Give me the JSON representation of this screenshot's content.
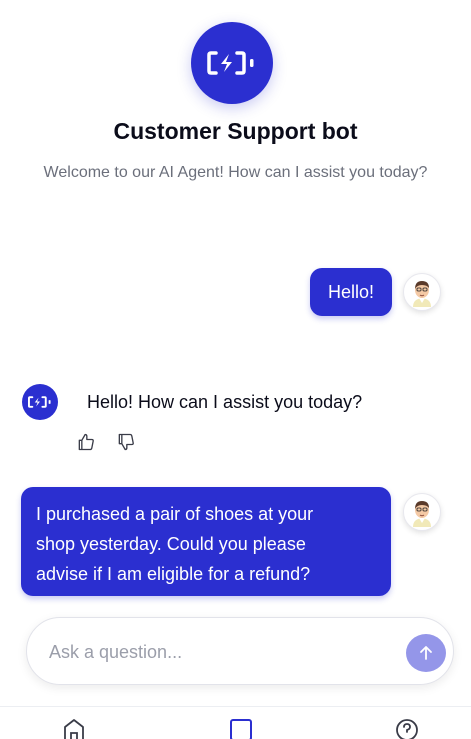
{
  "header": {
    "title": "Customer Support bot",
    "subtitle": "Welcome to our AI Agent! How can I assist you today?",
    "logo_icon": "bot-battery-icon"
  },
  "conversation": [
    {
      "role": "user",
      "text": "Hello!"
    },
    {
      "role": "bot",
      "text": "Hello! How can I assist you today?"
    },
    {
      "role": "user",
      "text": "I purchased a pair of shoes at your shop yesterday. Could you please advise if I am eligible for a refund?"
    }
  ],
  "refund_lines": [
    "I purchased a pair of shoes at your",
    "shop yesterday. Could you please",
    "advise if I am eligible for a refund?"
  ],
  "feedback": {
    "like_icon": "thumbs-up-icon",
    "dislike_icon": "thumbs-down-icon"
  },
  "composer": {
    "placeholder": "Ask a question...",
    "value": "",
    "send_icon": "arrow-up-icon"
  },
  "nav": {
    "items": [
      "home-icon",
      "square-icon",
      "help-icon"
    ]
  },
  "colors": {
    "accent": "#2b2fd0",
    "send_button": "#9496e9",
    "muted_text": "#6b6f7b"
  }
}
